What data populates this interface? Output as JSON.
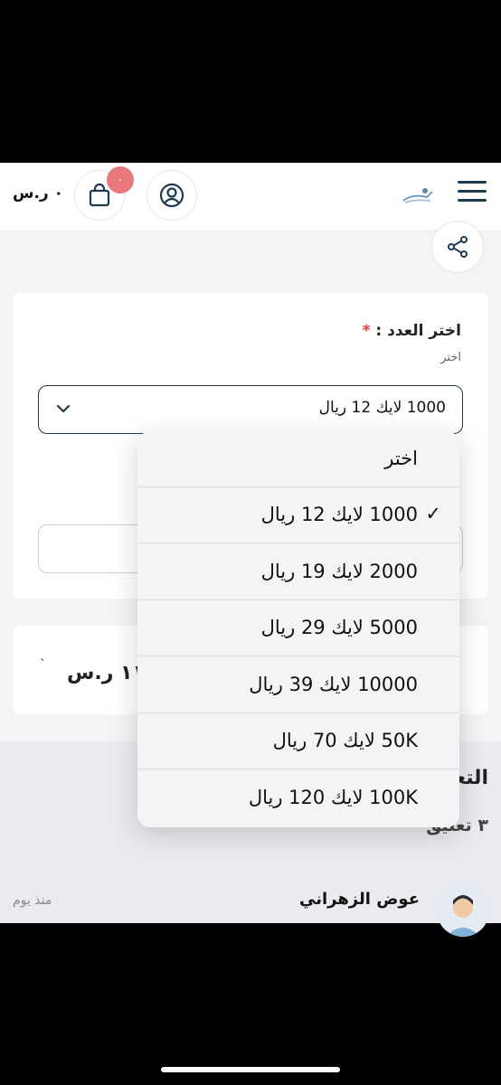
{
  "header": {
    "cart_total": "٠ ر.س",
    "cart_badge": "٠"
  },
  "form": {
    "label": "اختر العدد :",
    "required_mark": "*",
    "hint": "اختر",
    "selected_value": "1000 لايك 12 ريال"
  },
  "price": {
    "value": "١١ ر.س",
    "tick": "`"
  },
  "comments": {
    "title": "التعـ",
    "count": "٣ تعليق",
    "first": {
      "author": "عوض الزهراني",
      "time": "منذ يوم"
    }
  },
  "dropdown": {
    "options": [
      {
        "label": "اختر",
        "checked": false
      },
      {
        "label": "1000 لايك 12 ريال",
        "checked": true
      },
      {
        "label": "2000 لايك 19 ريال",
        "checked": false
      },
      {
        "label": "5000 لايك 29 ريال",
        "checked": false
      },
      {
        "label": "10000 لايك 39 ريال",
        "checked": false
      },
      {
        "label": "50K لايك 70 ريال",
        "checked": false
      },
      {
        "label": "100K لايك 120 ريال",
        "checked": false
      }
    ],
    "check_glyph": "✓"
  },
  "colors": {
    "accent": "#1f3a4d",
    "badge": "#e8787c",
    "required": "#e53935"
  }
}
